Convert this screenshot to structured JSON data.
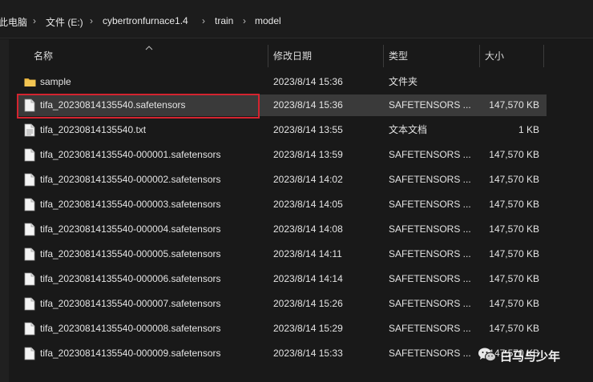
{
  "breadcrumb": {
    "items": [
      "此电脑",
      "文件 (E:)",
      "cybertronfurnace1.4",
      "train",
      "model"
    ]
  },
  "columns": {
    "name": "名称",
    "date": "修改日期",
    "type": "类型",
    "size": "大小"
  },
  "files": [
    {
      "name": "sample",
      "date": "2023/8/14 15:36",
      "type": "文件夹",
      "size": "",
      "kind": "folder",
      "selected": false
    },
    {
      "name": "tifa_20230814135540.safetensors",
      "date": "2023/8/14 15:36",
      "type": "SAFETENSORS ...",
      "size": "147,570 KB",
      "kind": "file",
      "selected": true
    },
    {
      "name": "tifa_20230814135540.txt",
      "date": "2023/8/14 13:55",
      "type": "文本文档",
      "size": "1 KB",
      "kind": "text",
      "selected": false
    },
    {
      "name": "tifa_20230814135540-000001.safetensors",
      "date": "2023/8/14 13:59",
      "type": "SAFETENSORS ...",
      "size": "147,570 KB",
      "kind": "file",
      "selected": false
    },
    {
      "name": "tifa_20230814135540-000002.safetensors",
      "date": "2023/8/14 14:02",
      "type": "SAFETENSORS ...",
      "size": "147,570 KB",
      "kind": "file",
      "selected": false
    },
    {
      "name": "tifa_20230814135540-000003.safetensors",
      "date": "2023/8/14 14:05",
      "type": "SAFETENSORS ...",
      "size": "147,570 KB",
      "kind": "file",
      "selected": false
    },
    {
      "name": "tifa_20230814135540-000004.safetensors",
      "date": "2023/8/14 14:08",
      "type": "SAFETENSORS ...",
      "size": "147,570 KB",
      "kind": "file",
      "selected": false
    },
    {
      "name": "tifa_20230814135540-000005.safetensors",
      "date": "2023/8/14 14:11",
      "type": "SAFETENSORS ...",
      "size": "147,570 KB",
      "kind": "file",
      "selected": false
    },
    {
      "name": "tifa_20230814135540-000006.safetensors",
      "date": "2023/8/14 14:14",
      "type": "SAFETENSORS ...",
      "size": "147,570 KB",
      "kind": "file",
      "selected": false
    },
    {
      "name": "tifa_20230814135540-000007.safetensors",
      "date": "2023/8/14 15:26",
      "type": "SAFETENSORS ...",
      "size": "147,570 KB",
      "kind": "file",
      "selected": false
    },
    {
      "name": "tifa_20230814135540-000008.safetensors",
      "date": "2023/8/14 15:29",
      "type": "SAFETENSORS ...",
      "size": "147,570 KB",
      "kind": "file",
      "selected": false
    },
    {
      "name": "tifa_20230814135540-000009.safetensors",
      "date": "2023/8/14 15:33",
      "type": "SAFETENSORS ...",
      "size": "147,570 KB",
      "kind": "file",
      "selected": false
    }
  ],
  "watermark": {
    "text": "白马与少年",
    "icon": "wechat-icon"
  },
  "colors": {
    "background": "#191919",
    "selected_row": "#3a3a3a",
    "highlight_border": "#d4242f",
    "folder": "#e8b33d"
  }
}
